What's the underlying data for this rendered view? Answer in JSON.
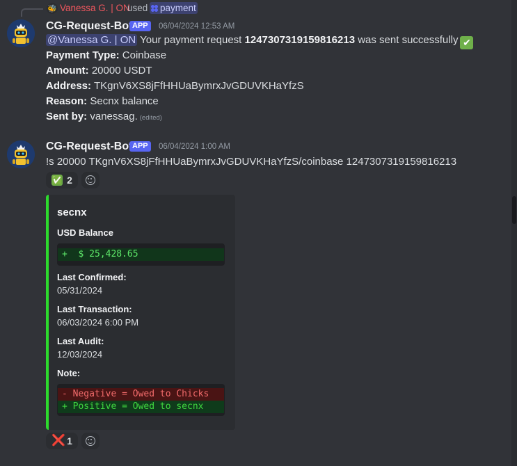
{
  "reply": {
    "username": "Vanessa G. | ON",
    "used_text": "used",
    "command": "payment"
  },
  "messages": [
    {
      "author": "CG-Request-Bot",
      "badge": "APP",
      "timestamp": "06/04/2024 12:53 AM",
      "mention": "@Vanessa G. | ON",
      "body_before": "Your payment request",
      "request_id": "1247307319159816213",
      "body_after": "was sent successfully",
      "fields": [
        {
          "label": "Payment Type:",
          "value": "Coinbase"
        },
        {
          "label": "Amount:",
          "value": "20000 USDT"
        },
        {
          "label": "Address:",
          "value": "TKgnV6XS8jFfHHUaBymrxJvGDUVKHaYfzS"
        },
        {
          "label": "Reason:",
          "value": " Secnx balance"
        },
        {
          "label": "Sent by:",
          "value": "vanessag."
        }
      ],
      "edited": "(edited)"
    },
    {
      "author": "CG-Request-Bot",
      "badge": "APP",
      "timestamp": "06/04/2024 1:00 AM",
      "command_text": "!s 20000 TKgnV6XS8jFfHHUaBymrxJvGDUVKHaYfzS/coinbase 1247307319159816213",
      "reaction": {
        "emoji": "✅",
        "count": "2"
      }
    }
  ],
  "embed": {
    "accent_color": "#2ddb2d",
    "title": "secnx",
    "usd_balance_label": "USD Balance",
    "usd_balance_value": "+  $ 25,428.65",
    "last_confirmed_label": "Last Confirmed:",
    "last_confirmed_value": "05/31/2024",
    "last_transaction_label": "Last Transaction:",
    "last_transaction_value": "06/03/2024 6:00 PM",
    "last_audit_label": "Last Audit:",
    "last_audit_value": "12/03/2024",
    "note_label": "Note:",
    "note_negative": "- Negative = Owed to Chicks",
    "note_positive": "+ Positive = Owed to secnx"
  },
  "embed_reaction": {
    "emoji": "❌",
    "count": "1"
  },
  "icons": {
    "bot_avatar": "robot-avatar-icon",
    "add_reaction": "add-reaction-icon",
    "command": "slash-command-icon"
  }
}
